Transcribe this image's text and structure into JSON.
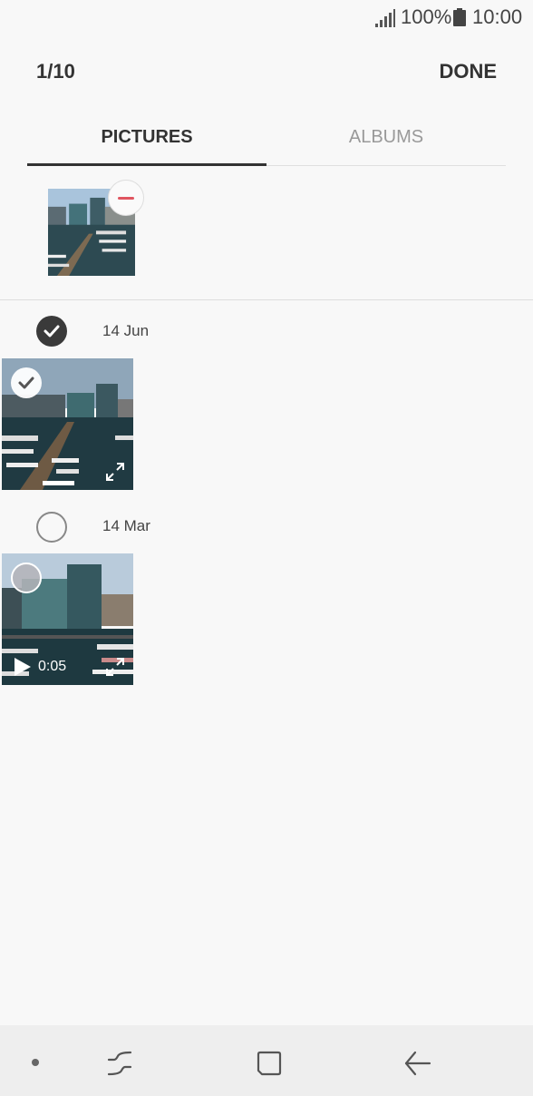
{
  "status_bar": {
    "battery_percent": "100%",
    "time": "10:00",
    "signal_icon": "signal-icon",
    "battery_icon": "battery-icon"
  },
  "header": {
    "counter": "1/10",
    "done_label": "DONE"
  },
  "tabs": [
    {
      "label": "PICTURES",
      "active": true
    },
    {
      "label": "ALBUMS",
      "active": false
    }
  ],
  "selected_tray": {
    "items": [
      {
        "type": "photo",
        "remove_icon": "minus-icon"
      }
    ]
  },
  "groups": [
    {
      "date": "14 Jun",
      "checked": true,
      "items": [
        {
          "type": "photo",
          "checked": true
        }
      ]
    },
    {
      "date": "14 Mar",
      "checked": false,
      "items": [
        {
          "type": "video",
          "checked": false,
          "duration": "0:05"
        }
      ]
    }
  ],
  "navigation_bar": {
    "icons": [
      "dot-icon",
      "recents-icon",
      "home-icon",
      "back-icon"
    ]
  },
  "colors": {
    "background": "#f8f8f8",
    "accent_dark": "#333333",
    "remove_red": "#e05560",
    "nav_bg": "#eeeeee"
  }
}
